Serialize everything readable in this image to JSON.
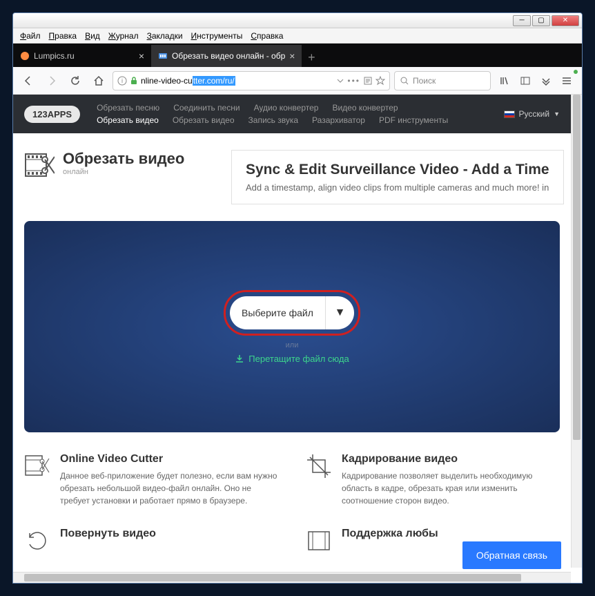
{
  "menubar": [
    "Файл",
    "Правка",
    "Вид",
    "Журнал",
    "Закладки",
    "Инструменты",
    "Справка"
  ],
  "tabs": [
    {
      "label": "Lumpics.ru",
      "active": false
    },
    {
      "label": "Обрезать видео онлайн - обр",
      "active": true
    }
  ],
  "url": {
    "prefix": "nline-video-cu",
    "selected": "tter.com/ru/"
  },
  "search": {
    "placeholder": "Поиск"
  },
  "logo": "123APPS",
  "nav": {
    "row1": [
      "Обрезать песню",
      "Соединить песни",
      "Аудио конвертер",
      "Видео конвертер"
    ],
    "row2": [
      "Обрезать видео",
      "Обрезать видео",
      "Запись звука",
      "Разархиватор",
      "PDF инструменты"
    ],
    "active": "Обрезать видео"
  },
  "lang": "Русский",
  "header": {
    "title": "Обрезать видео",
    "sub": "онлайн"
  },
  "ad": {
    "title": "Sync & Edit Surveillance Video - Add a Time",
    "text": "Add a timestamp, align video clips from multiple cameras and much more! in"
  },
  "upload": {
    "button": "Выберите файл",
    "or": "или",
    "drag": "Перетащите файл сюда"
  },
  "features": [
    {
      "title": "Online Video Cutter",
      "text": "Данное веб-приложение будет полезно, если вам нужно обрезать небольшой видео-файл онлайн. Оно не требует установки и работает прямо в браузере."
    },
    {
      "title": "Кадрирование видео",
      "text": "Кадрирование позволяет выделить необходимую область в кадре, обрезать края или изменить соотношение сторон видео."
    },
    {
      "title": "Повернуть видео",
      "text": ""
    },
    {
      "title": "Поддержка любы",
      "text": ""
    }
  ],
  "feedback": "Обратная связь"
}
